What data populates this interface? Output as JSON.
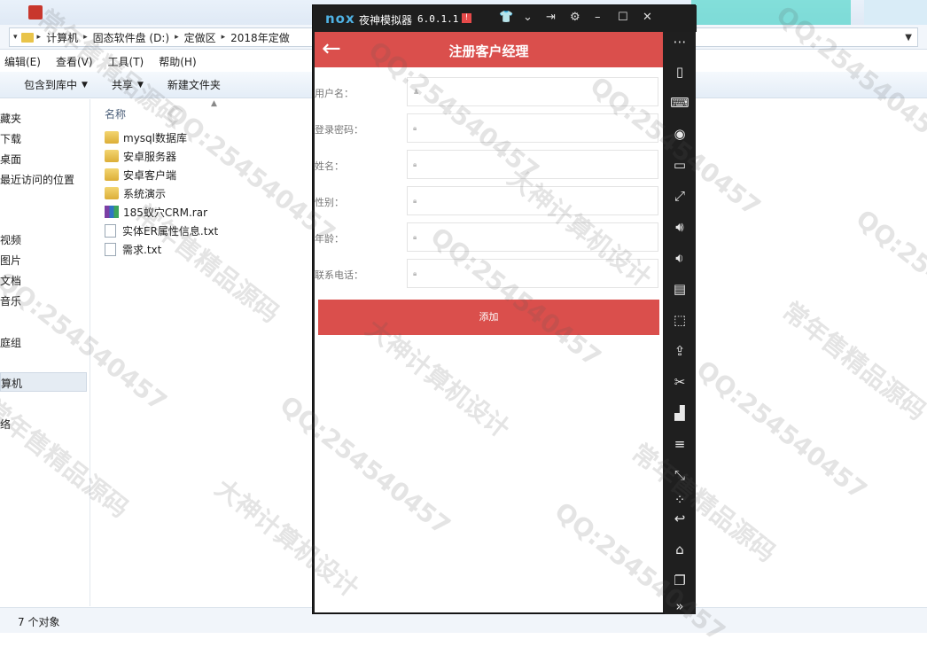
{
  "explorer": {
    "address": {
      "segments": [
        "计算机",
        "固态软件盘 (D:)",
        "定做区",
        "2018年定做"
      ]
    },
    "menu": [
      "编辑(E)",
      "查看(V)",
      "工具(T)",
      "帮助(H)"
    ],
    "toolbar": {
      "include_library": "包含到库中",
      "share": "共享",
      "new_folder": "新建文件夹"
    },
    "nav": {
      "items": [
        "藏夹",
        "下载",
        "桌面",
        "最近访问的位置",
        "视频",
        "图片",
        "文档",
        "音乐",
        "庭组",
        "算机",
        "络"
      ]
    },
    "column_header": "名称",
    "files": [
      {
        "name": "mysql数据库",
        "type": "folder"
      },
      {
        "name": "安卓服务器",
        "type": "folder"
      },
      {
        "name": "安卓客户端",
        "type": "folder"
      },
      {
        "name": "系统演示",
        "type": "folder"
      },
      {
        "name": "185蚁穴CRM.rar",
        "type": "rar"
      },
      {
        "name": "实体ER属性信息.txt",
        "type": "txt"
      },
      {
        "name": "需求.txt",
        "type": "txt"
      }
    ],
    "status": "7 个对象"
  },
  "emulator": {
    "logo": "nox",
    "name": "夜神模拟器",
    "version": "6.0.1.1",
    "alert": "!",
    "app": {
      "title": "注册客户经理",
      "fields": [
        {
          "label": "用户名："
        },
        {
          "label": "登录密码："
        },
        {
          "label": "姓名："
        },
        {
          "label": "性别："
        },
        {
          "label": "年龄："
        },
        {
          "label": "联系电话："
        }
      ],
      "submit": "添加"
    },
    "sidebar_icons": [
      "more-icon",
      "shake-icon",
      "keyboard-icon",
      "location-icon",
      "screen-icon",
      "fullscreen-icon",
      "volume-up-icon",
      "volume-down-icon",
      "toolbox-icon",
      "screenshot-icon",
      "apk-icon",
      "scissors-icon",
      "multi-instance-icon",
      "menu-icon",
      "resize-icon",
      "loading-icon",
      "back-icon",
      "home-icon",
      "recents-icon",
      "expand-icon"
    ]
  },
  "watermarks": [
    "QQ:254540457",
    "常年售精品源码",
    "大神计算机设计"
  ]
}
